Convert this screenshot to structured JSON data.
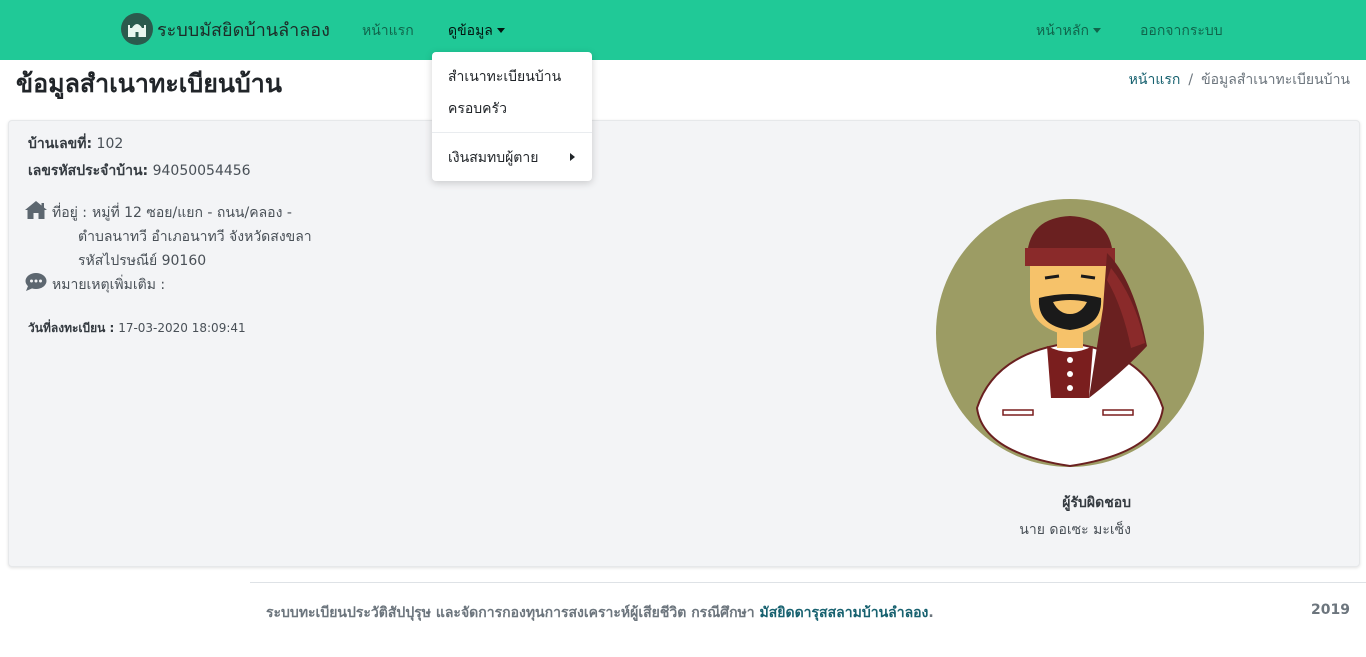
{
  "navbar": {
    "brand": "ระบบมัสยิดบ้านลำลอง",
    "home_link": "หน้าแรก",
    "view_data": "ดูข้อมูล",
    "main_menu": "หน้าหลัก",
    "logout": "ออกจากระบบ"
  },
  "dropdown": {
    "items": [
      "สำเนาทะเบียนบ้าน",
      "ครอบครัว",
      "เงินสมทบผู้ตาย"
    ]
  },
  "page": {
    "title": "ข้อมูลสำเนาทะเบียนบ้าน",
    "breadcrumb_home": "หน้าแรก",
    "breadcrumb_sep": "/",
    "breadcrumb_current": "ข้อมูลสำเนาทะเบียนบ้าน"
  },
  "house": {
    "number_label": "บ้านเลขที่:",
    "number_value": "102",
    "code_label": "เลขรหัสประจำบ้าน:",
    "code_value": "94050054456",
    "address_label": "ที่อยู่ :",
    "address_line1": "หมู่ที่ 12 ซอย/แยก - ถนน/คลอง -",
    "address_line2": "ตำบลนาทวี อำเภอนาทวี จังหวัดสงขลา",
    "address_line3": "รหัสไปรษณีย์ 90160",
    "note_label": "หมายเหตุเพิ่มเติม :",
    "note_value": "",
    "reg_date_label": "วันที่ลงทะเบียน :",
    "reg_date_value": "17-03-2020 18:09:41"
  },
  "responsible": {
    "title": "ผู้รับผิดชอบ",
    "name": "นาย ดอเซะ มะเซ็ง"
  },
  "footer": {
    "text": "ระบบทะเบียนประวัติสัปปุรุษ และจัดการกองทุนการสงเคราะห์ผู้เสียชีวิต กรณีศึกษา",
    "link": "มัสยิดดารุสสลามบ้านลำลอง",
    "link_suffix": ".",
    "year": "2019"
  },
  "colors": {
    "navbar": "#20c997",
    "link": "#17616f",
    "card_bg": "#f3f4f6",
    "avatar_bg": "#9c9c64"
  },
  "icons": [
    "mosque-logo-icon",
    "home-icon",
    "comment-icon"
  ]
}
